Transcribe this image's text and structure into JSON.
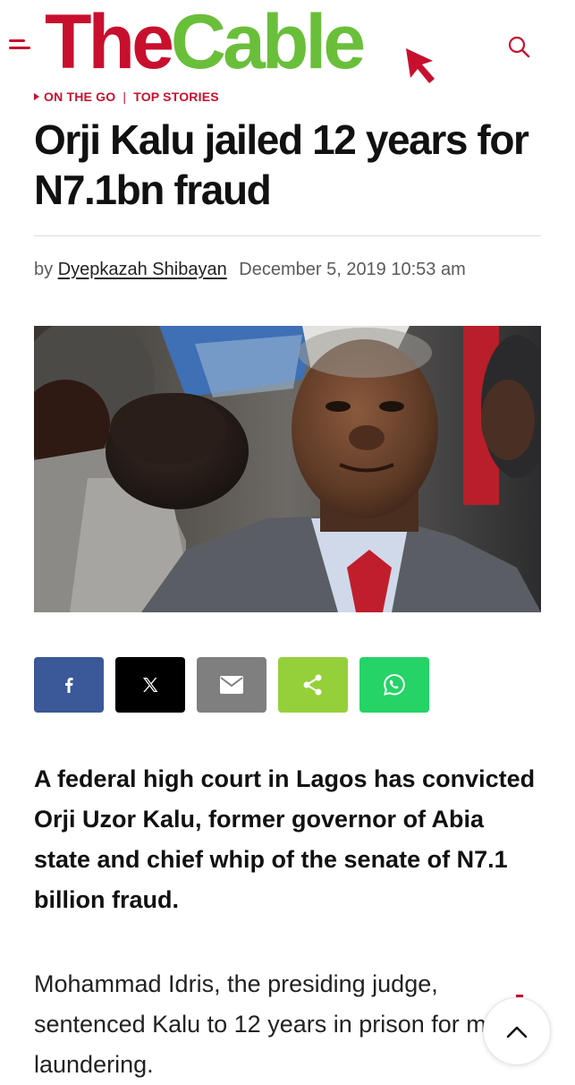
{
  "site": {
    "logo_the": "The",
    "logo_cable": "Cable",
    "brand_red": "#c8102e",
    "brand_green": "#6abf3a"
  },
  "header": {
    "menu_icon": "hamburger-menu-icon",
    "search_icon": "search-icon"
  },
  "article": {
    "categories": [
      "ON THE GO",
      "TOP STORIES"
    ],
    "title": "Orji Kalu jailed 12 years for N7.1bn fraud",
    "byline_prefix": "by",
    "author": "Dyepkazah Shibayan",
    "date": "December 5, 2019 10:53 am",
    "lead": "A federal high court in Lagos has convicted Orji Uzor Kalu, former governor of Abia state and chief whip of the senate of N7.1 billion fraud.",
    "paragraph": "Mohammad Idris, the presiding judge, sentenced Kalu to 12 years in prison for money laundering."
  },
  "share": [
    {
      "name": "facebook",
      "icon": "facebook-icon",
      "color": "#3b5998"
    },
    {
      "name": "x",
      "icon": "x-icon",
      "color": "#000000"
    },
    {
      "name": "email",
      "icon": "email-icon",
      "color": "#7f7f7f"
    },
    {
      "name": "share",
      "icon": "share-icon",
      "color": "#95d03a"
    },
    {
      "name": "whatsapp",
      "icon": "whatsapp-icon",
      "color": "#25d366"
    }
  ],
  "scroll_top_icon": "chevron-up-icon"
}
